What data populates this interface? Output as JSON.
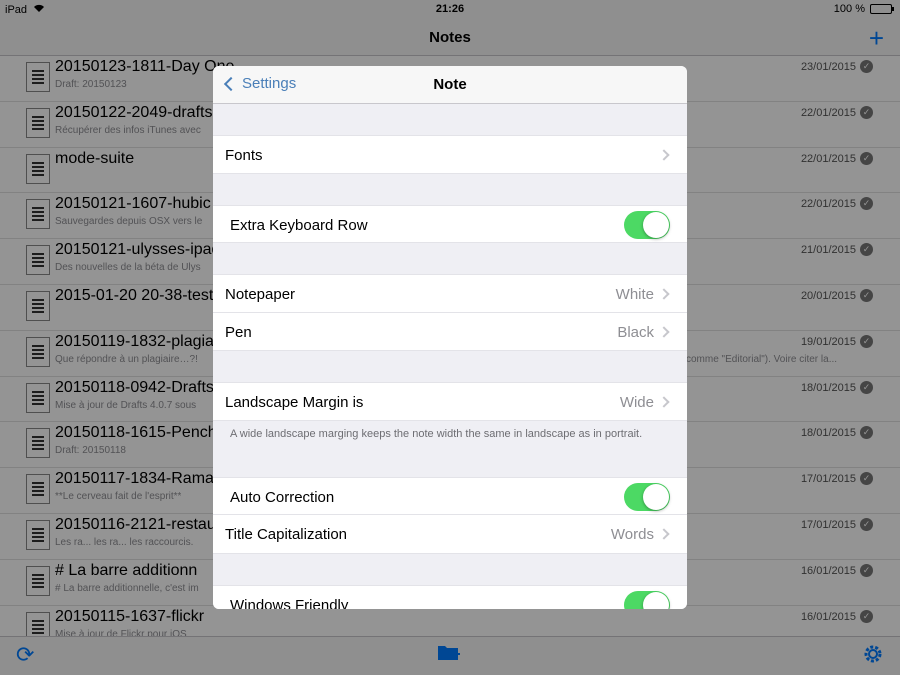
{
  "status_bar": {
    "device": "iPad",
    "time": "21:26",
    "battery": "100 %",
    "battery_level": 1.0
  },
  "nav": {
    "title": "Notes",
    "add_icon": "plus-icon"
  },
  "notes": [
    {
      "title": "20150123-1811-Day One",
      "subtitle": "Draft: 20150123",
      "date": "23/01/2015"
    },
    {
      "title": "20150122-2049-drafts",
      "subtitle": "Récupérer des infos iTunes avec",
      "date": "22/01/2015"
    },
    {
      "title": "mode-suite",
      "subtitle": "",
      "date": "22/01/2015"
    },
    {
      "title": "20150121-1607-hubic",
      "subtitle": "Sauvegardes depuis OSX vers le",
      "date": "22/01/2015"
    },
    {
      "title": "20150121-ulysses-ipad",
      "subtitle": "Des nouvelles de la béta de Ulys",
      "date": "21/01/2015"
    },
    {
      "title": "2015-01-20 20-38-test",
      "subtitle": "",
      "date": "20/01/2015"
    },
    {
      "title": "20150119-1832-plagiat",
      "subtitle": "Que répondre à un plagiaire…?!",
      "subtitle_right": "comme \"Editorial\"). Voire citer la...",
      "date": "19/01/2015"
    },
    {
      "title": "20150118-0942-Drafts",
      "subtitle": "Mise à jour de Drafts 4.0.7 sous",
      "date": "18/01/2015"
    },
    {
      "title": "20150118-1615-Pench",
      "subtitle": "Draft: 20150118",
      "date": "18/01/2015"
    },
    {
      "title": "20150117-1834-Rama",
      "subtitle": "**Le cerveau fait de l'esprit**",
      "date": "17/01/2015"
    },
    {
      "title": "20150116-2121-restau",
      "subtitle": "Les ra... les ra... les raccourcis.",
      "date": "17/01/2015"
    },
    {
      "title": "# La barre additionn",
      "subtitle": "# La barre additionnelle, c'est im",
      "date": "16/01/2015"
    },
    {
      "title": "20150115-1637-flickr",
      "subtitle": "Mise à jour de Flickr pour iOS",
      "date": "16/01/2015"
    }
  ],
  "toolbar": {
    "refresh_icon": "refresh-icon",
    "new_folder_icon": "folder-add-icon",
    "settings_icon": "gear-icon"
  },
  "modal": {
    "back_label": "Settings",
    "title": "Note",
    "fonts_label": "Fonts",
    "extra_keyboard_row_label": "Extra Keyboard Row",
    "extra_keyboard_row_on": true,
    "notepaper_label": "Notepaper",
    "notepaper_value": "White",
    "pen_label": "Pen",
    "pen_value": "Black",
    "landscape_margin_label": "Landscape Margin is",
    "landscape_margin_value": "Wide",
    "landscape_footnote": "A wide landscape marging keeps the note width the same in landscape as in portrait.",
    "auto_correction_label": "Auto Correction",
    "auto_correction_on": true,
    "title_capitalization_label": "Title Capitalization",
    "title_capitalization_value": "Words",
    "windows_friendly_label": "Windows Friendly",
    "windows_friendly_on": true
  },
  "colors": {
    "accent": "#007aff",
    "switch_on": "#4cd964",
    "back_link": "#4a7fb8"
  }
}
